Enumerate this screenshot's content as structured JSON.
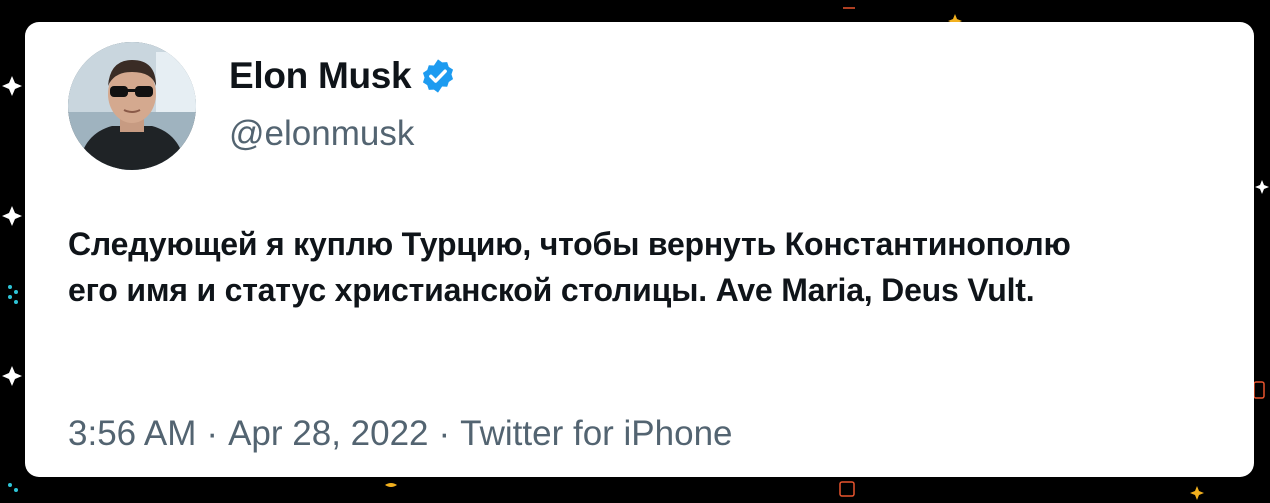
{
  "tweet": {
    "author": {
      "display_name": "Elon Musk",
      "handle": "@elonmusk",
      "verified": true,
      "avatar_icon": "profile-photo"
    },
    "text_lines": [
      "Следующей я куплю Турцию, чтобы вернуть Константинополю",
      "его имя и статус христианской столицы. Ave Maria, Deus Vult."
    ],
    "time": "3:56 AM",
    "date": "Apr 28, 2022",
    "source": "Twitter for iPhone",
    "separator": "·"
  },
  "colors": {
    "page_background": "#000000",
    "card_background": "#ffffff",
    "primary_text": "#0f1419",
    "secondary_text": "#536471",
    "verified_blue": "#1d9bf0"
  }
}
